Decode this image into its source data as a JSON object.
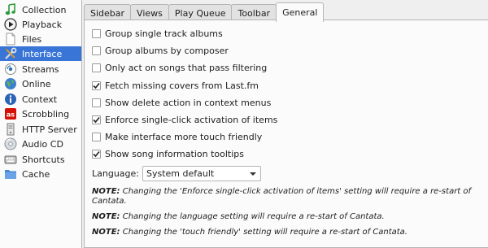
{
  "sidebar": {
    "items": [
      {
        "label": "Collection",
        "icon": "music-note-icon"
      },
      {
        "label": "Playback",
        "icon": "play-icon"
      },
      {
        "label": "Files",
        "icon": "file-icon"
      },
      {
        "label": "Interface",
        "icon": "interface-tools-icon",
        "selected": true
      },
      {
        "label": "Streams",
        "icon": "stream-icon"
      },
      {
        "label": "Online",
        "icon": "globe-icon"
      },
      {
        "label": "Context",
        "icon": "info-icon"
      },
      {
        "label": "Scrobbling",
        "icon": "lastfm-icon"
      },
      {
        "label": "HTTP Server",
        "icon": "server-icon"
      },
      {
        "label": "Audio CD",
        "icon": "cd-icon"
      },
      {
        "label": "Shortcuts",
        "icon": "keyboard-icon"
      },
      {
        "label": "Cache",
        "icon": "folder-icon"
      }
    ]
  },
  "tabs": [
    {
      "label": "Sidebar",
      "active": false
    },
    {
      "label": "Views",
      "active": false
    },
    {
      "label": "Play Queue",
      "active": false
    },
    {
      "label": "Toolbar",
      "active": false
    },
    {
      "label": "General",
      "active": true
    }
  ],
  "options": [
    {
      "label": "Group single track albums",
      "checked": false
    },
    {
      "label": "Group albums by composer",
      "checked": false
    },
    {
      "label": "Only act on songs that pass filtering",
      "checked": false
    },
    {
      "label": "Fetch missing covers from Last.fm",
      "checked": true
    },
    {
      "label": "Show delete action in context menus",
      "checked": false
    },
    {
      "label": "Enforce single-click activation of items",
      "checked": true
    },
    {
      "label": "Make interface more touch friendly",
      "checked": false
    },
    {
      "label": "Show song information tooltips",
      "checked": true
    }
  ],
  "language": {
    "label": "Language:",
    "value": "System default"
  },
  "notes": [
    {
      "prefix": "NOTE:",
      "text": " Changing the 'Enforce single-click activation of items' setting will require a re-start of Cantata."
    },
    {
      "prefix": "NOTE:",
      "text": " Changing the language setting will require a re-start of Cantata."
    },
    {
      "prefix": "NOTE:",
      "text": " Changing the 'touch friendly' setting will require a re-start of Cantata."
    }
  ],
  "colors": {
    "selection": "#3875d7",
    "panel": "#fbfbfb",
    "window": "#efefef"
  }
}
